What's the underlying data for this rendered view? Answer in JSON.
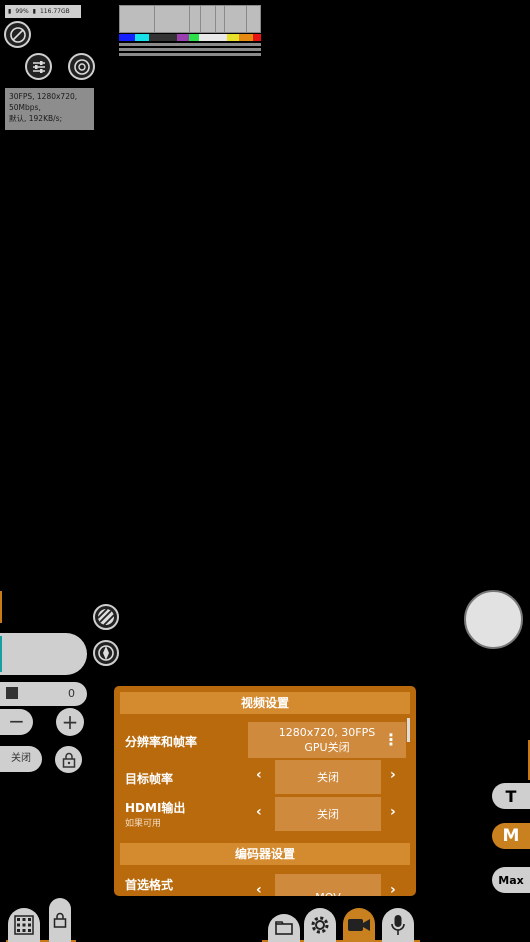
{
  "status": {
    "battery": "99%",
    "storage": "116.77GB"
  },
  "info_lines": [
    "30FPS, 1280x720,",
    "50Mbps,",
    "默认, 192KB/s;"
  ],
  "exposure": {
    "value": "0"
  },
  "lock_toggle": {
    "label": "关闭"
  },
  "panel": {
    "video_header": "视频设置",
    "resolution": {
      "label": "分辨率和帧率",
      "value_line1": "1280x720, 30FPS",
      "value_line2": "GPU关闭"
    },
    "target_fps": {
      "label": "目标帧率",
      "value": "关闭"
    },
    "hdmi": {
      "label": "HDMI输出",
      "sublabel": "如果可用",
      "value": "关闭"
    },
    "encoder_header": "编码器设置",
    "format": {
      "label": "首选格式",
      "value": "MOV"
    }
  },
  "modes": {
    "t": "T",
    "m": "M",
    "max": "Max"
  },
  "colors": {
    "accent": "#b86a0c",
    "header": "#d48a2f"
  }
}
